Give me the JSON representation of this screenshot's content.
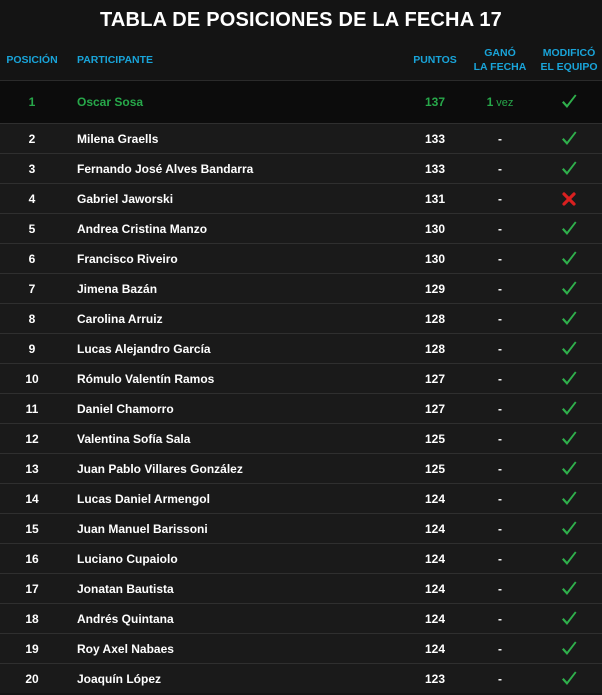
{
  "title": "TABLA DE POSICIONES DE LA FECHA 17",
  "headers": {
    "position": "POSICIÓN",
    "participant": "PARTICIPANTE",
    "points": "PUNTOS",
    "won_line1": "GANÓ",
    "won_line2": "LA FECHA",
    "modified_line1": "MODIFICÓ",
    "modified_line2": "EL EQUIPO"
  },
  "colors": {
    "accent_header": "#19a4d9",
    "leader_green": "#27a84a",
    "check_green": "#2fb04c",
    "cross_red": "#d92020",
    "background": "#141414"
  },
  "rows": [
    {
      "pos": "1",
      "name": "Oscar Sosa",
      "points": "137",
      "won": "1",
      "won_unit": "vez",
      "modified": "check-icon"
    },
    {
      "pos": "2",
      "name": "Milena Graells",
      "points": "133",
      "won": "-",
      "won_unit": "",
      "modified": "check-icon"
    },
    {
      "pos": "3",
      "name": "Fernando José Alves Bandarra",
      "points": "133",
      "won": "-",
      "won_unit": "",
      "modified": "check-icon"
    },
    {
      "pos": "4",
      "name": "Gabriel Jaworski",
      "points": "131",
      "won": "-",
      "won_unit": "",
      "modified": "cross-icon"
    },
    {
      "pos": "5",
      "name": "Andrea Cristina Manzo",
      "points": "130",
      "won": "-",
      "won_unit": "",
      "modified": "check-icon"
    },
    {
      "pos": "6",
      "name": "Francisco Riveiro",
      "points": "130",
      "won": "-",
      "won_unit": "",
      "modified": "check-icon"
    },
    {
      "pos": "7",
      "name": "Jimena Bazán",
      "points": "129",
      "won": "-",
      "won_unit": "",
      "modified": "check-icon"
    },
    {
      "pos": "8",
      "name": "Carolina Arruiz",
      "points": "128",
      "won": "-",
      "won_unit": "",
      "modified": "check-icon"
    },
    {
      "pos": "9",
      "name": "Lucas Alejandro García",
      "points": "128",
      "won": "-",
      "won_unit": "",
      "modified": "check-icon"
    },
    {
      "pos": "10",
      "name": "Rómulo Valentín Ramos",
      "points": "127",
      "won": "-",
      "won_unit": "",
      "modified": "check-icon"
    },
    {
      "pos": "11",
      "name": "Daniel Chamorro",
      "points": "127",
      "won": "-",
      "won_unit": "",
      "modified": "check-icon"
    },
    {
      "pos": "12",
      "name": "Valentina Sofía Sala",
      "points": "125",
      "won": "-",
      "won_unit": "",
      "modified": "check-icon"
    },
    {
      "pos": "13",
      "name": "Juan Pablo Villares González",
      "points": "125",
      "won": "-",
      "won_unit": "",
      "modified": "check-icon"
    },
    {
      "pos": "14",
      "name": "Lucas Daniel Armengol",
      "points": "124",
      "won": "-",
      "won_unit": "",
      "modified": "check-icon"
    },
    {
      "pos": "15",
      "name": "Juan Manuel Barissoni",
      "points": "124",
      "won": "-",
      "won_unit": "",
      "modified": "check-icon"
    },
    {
      "pos": "16",
      "name": "Luciano Cupaiolo",
      "points": "124",
      "won": "-",
      "won_unit": "",
      "modified": "check-icon"
    },
    {
      "pos": "17",
      "name": "Jonatan Bautista",
      "points": "124",
      "won": "-",
      "won_unit": "",
      "modified": "check-icon"
    },
    {
      "pos": "18",
      "name": "Andrés Quintana",
      "points": "124",
      "won": "-",
      "won_unit": "",
      "modified": "check-icon"
    },
    {
      "pos": "19",
      "name": "Roy Axel Nabaes",
      "points": "124",
      "won": "-",
      "won_unit": "",
      "modified": "check-icon"
    },
    {
      "pos": "20",
      "name": "Joaquín López",
      "points": "123",
      "won": "-",
      "won_unit": "",
      "modified": "check-icon"
    }
  ]
}
